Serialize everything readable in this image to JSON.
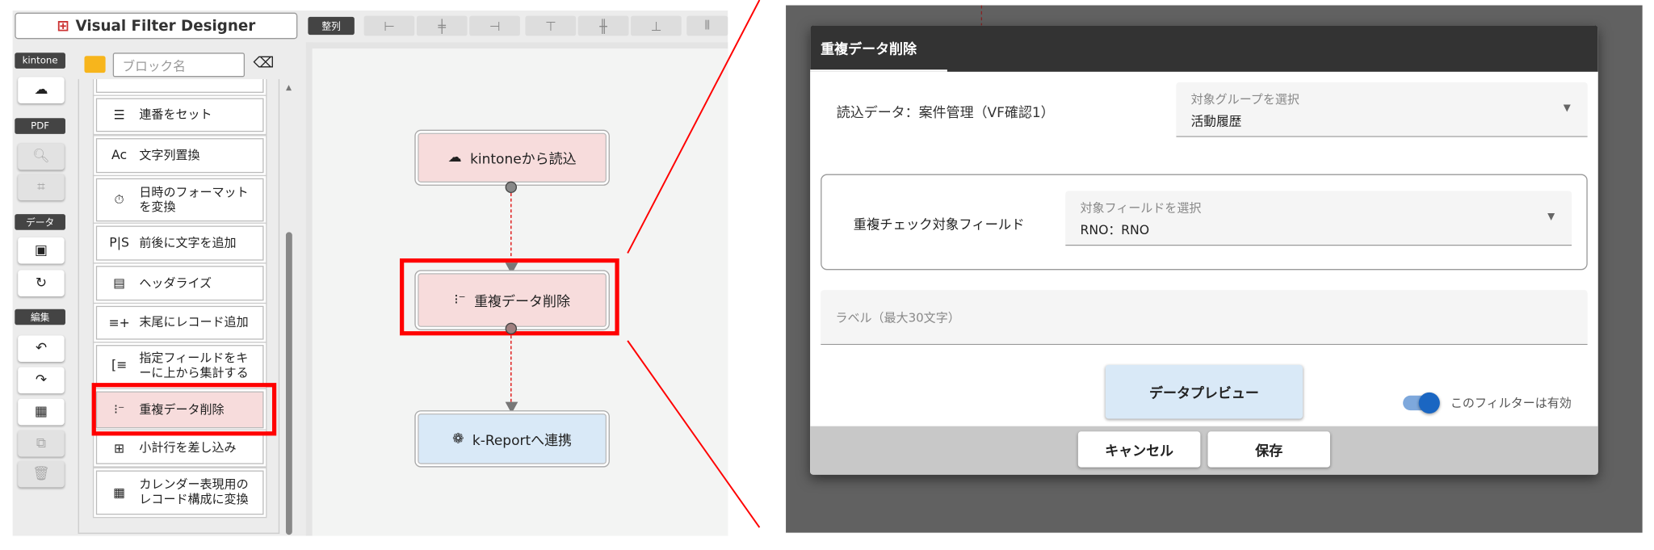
{
  "app": {
    "title": "Visual Filter Designer",
    "align_label": "整列",
    "align_buttons": [
      "align-left",
      "align-center",
      "align-right",
      "align-top",
      "align-middle",
      "align-bottom",
      "distribute"
    ]
  },
  "sidebar": {
    "categories": {
      "kintone": "kintone",
      "pdf": "PDF",
      "data": "データ",
      "edit": "編集"
    }
  },
  "search": {
    "placeholder": "ブロック名"
  },
  "blocks": [
    {
      "label": "連番をセット",
      "icon": "numbered-list-icon"
    },
    {
      "label": "文字列置換",
      "icon": "text-replace-icon"
    },
    {
      "label": "日時のフォーマットを変換",
      "icon": "timer-icon"
    },
    {
      "label": "前後に文字を追加",
      "icon": "text-insert-icon"
    },
    {
      "label": "ヘッダライズ",
      "icon": "abc-header-icon"
    },
    {
      "label": "末尾にレコード追加",
      "icon": "playlist-add-icon"
    },
    {
      "label": "指定フィールドをキーに上から集計する",
      "icon": "aggregate-icon"
    },
    {
      "label": "重複データ削除",
      "icon": "dedupe-icon"
    },
    {
      "label": "小計行を差し込み",
      "icon": "table-add-icon"
    },
    {
      "label": "カレンダー表現用のレコード構成に変換",
      "icon": "calendar-icon"
    }
  ],
  "flow": {
    "nodes": [
      {
        "label": "kintoneから読込"
      },
      {
        "label": "重複データ削除"
      },
      {
        "label": "k-Reportへ連携"
      }
    ]
  },
  "dialog": {
    "title": "重複データ削除",
    "read_data": "読込データ：案件管理（VF確認1）",
    "group_select": {
      "label": "対象グループを選択",
      "value": "活動履歴"
    },
    "dup_field_label": "重複チェック対象フィールド",
    "field_select": {
      "label": "対象フィールドを選択",
      "value": "RNO：RNO"
    },
    "label_input": {
      "placeholder": "ラベル（最大30文字）"
    },
    "preview_button": "データプレビュー",
    "toggle": {
      "label": "このフィルターは有効",
      "on": true
    },
    "cancel": "キャンセル",
    "save": "保存"
  },
  "colors": {
    "highlight": "#ff0000",
    "node_pink": "#f7dcdc",
    "node_blue": "#d9e9f7",
    "toggle": "#1a66c2"
  }
}
